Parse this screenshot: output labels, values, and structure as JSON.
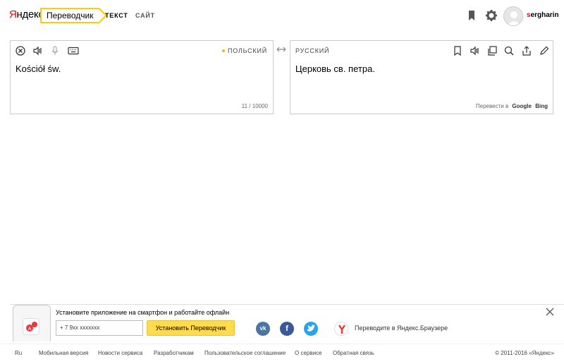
{
  "header": {
    "logo_y": "Я",
    "logo_rest": "ндекс",
    "service": "Переводчик",
    "tab_text": "ТЕКСТ",
    "tab_site": "САЙТ",
    "user_first": "s",
    "user_rest": "ergharin"
  },
  "source": {
    "language": "ПОЛЬСКИЙ",
    "text": "Kościół św.",
    "char_count": "11 / 10000"
  },
  "target": {
    "language": "РУССКИЙ",
    "text": "Церковь св. петра.",
    "translate_in": "Перевести в",
    "engine_google": "Google",
    "engine_bing": "Bing"
  },
  "promo": {
    "title": "Установите приложение на смартфон и работайте офлайн",
    "phone_value": "+ 7 9xx xxxxxxx",
    "install_label": "Установить Переводчик",
    "vk_label": "vk",
    "fb_label": "f",
    "browser_text": "Переводите в Яндекс.Браузере"
  },
  "footer": {
    "links": [
      "Ru",
      "Мобильная версия",
      "Новости сервиса",
      "Разработчикам",
      "Пользовательское соглашение",
      "О сервисе",
      "Обратная связь"
    ],
    "copyright": "© 2011-2016 «Яндекс»"
  },
  "colors": {
    "brand_yellow": "#ffcc00",
    "button_yellow": "#ffdb4d",
    "vk": "#4d75a3",
    "facebook": "#3b5998",
    "twitter": "#2aa3ef",
    "yandex_red": "#ff0000"
  },
  "icons": [
    "bookmark-icon",
    "settings-icon",
    "clear-icon",
    "speaker-icon",
    "microphone-icon",
    "keyboard-icon",
    "swap-icon",
    "copy-icon",
    "search-icon",
    "share-icon",
    "edit-icon",
    "close-icon",
    "yandex-browser-icon",
    "translator-app-icon"
  ]
}
